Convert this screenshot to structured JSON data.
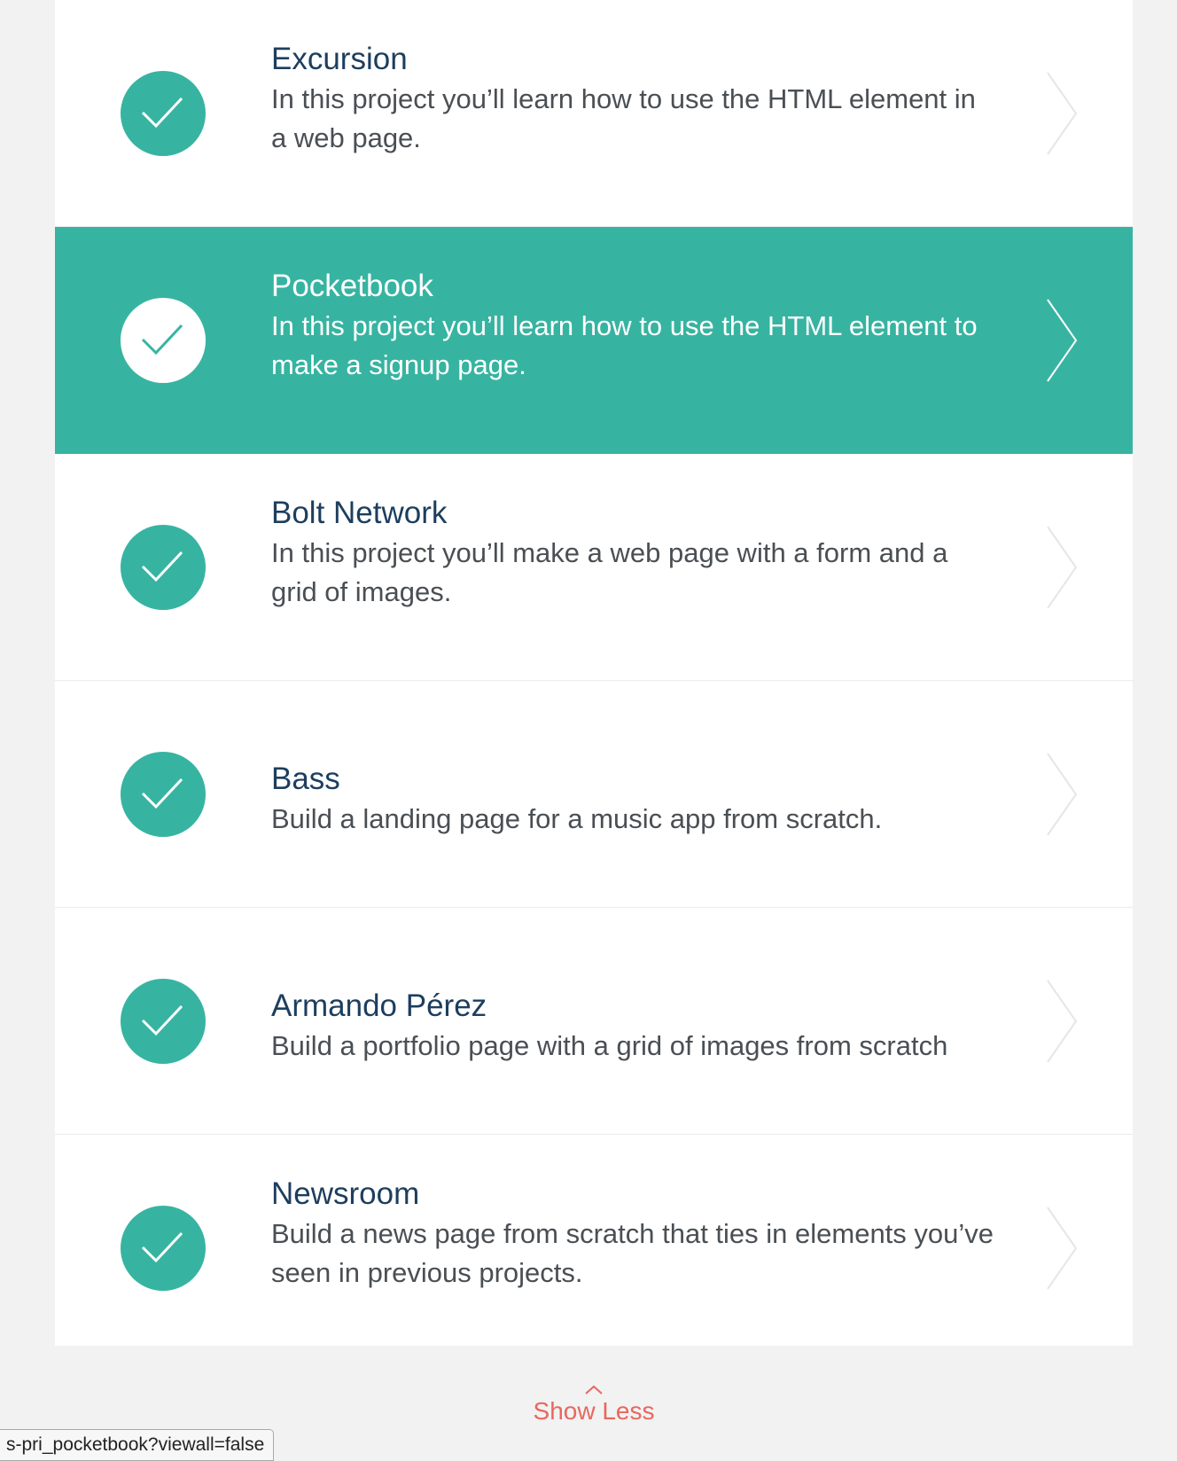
{
  "colors": {
    "accent": "#37b4a1",
    "title": "#1d3e5e",
    "description": "#4a4f54",
    "show_less": "#e8675f",
    "background": "#f1f2f1"
  },
  "projects": [
    {
      "title": "Excursion",
      "description": "In this project you’ll learn how to use the HTML element in a web page.",
      "status_icon": "check-icon",
      "nav_icon": "chevron-right-icon"
    },
    {
      "title": "Pocketbook",
      "description": "In this project you’ll learn how to use the HTML element to make a signup page.",
      "status_icon": "check-icon",
      "nav_icon": "chevron-right-icon",
      "highlighted": true
    },
    {
      "title": "Bolt Network",
      "description": "In this project you’ll make a web page with a form and a grid of images.",
      "status_icon": "check-icon",
      "nav_icon": "chevron-right-icon"
    },
    {
      "title": "Bass",
      "description": "Build a landing page for a music app from scratch.",
      "status_icon": "check-icon",
      "nav_icon": "chevron-right-icon"
    },
    {
      "title": "Armando Pérez",
      "description": "Build a portfolio page with a grid of images from scratch",
      "status_icon": "check-icon",
      "nav_icon": "chevron-right-icon"
    },
    {
      "title": "Newsroom",
      "description": "Build a news page from scratch that ties in elements you’ve seen in previous projects.",
      "status_icon": "check-icon",
      "nav_icon": "chevron-right-icon"
    }
  ],
  "footer": {
    "show_less_label": "Show Less",
    "show_less_icon": "chevron-up-icon"
  },
  "status_bar": {
    "url": "s-pri_pocketbook?viewall=false"
  }
}
